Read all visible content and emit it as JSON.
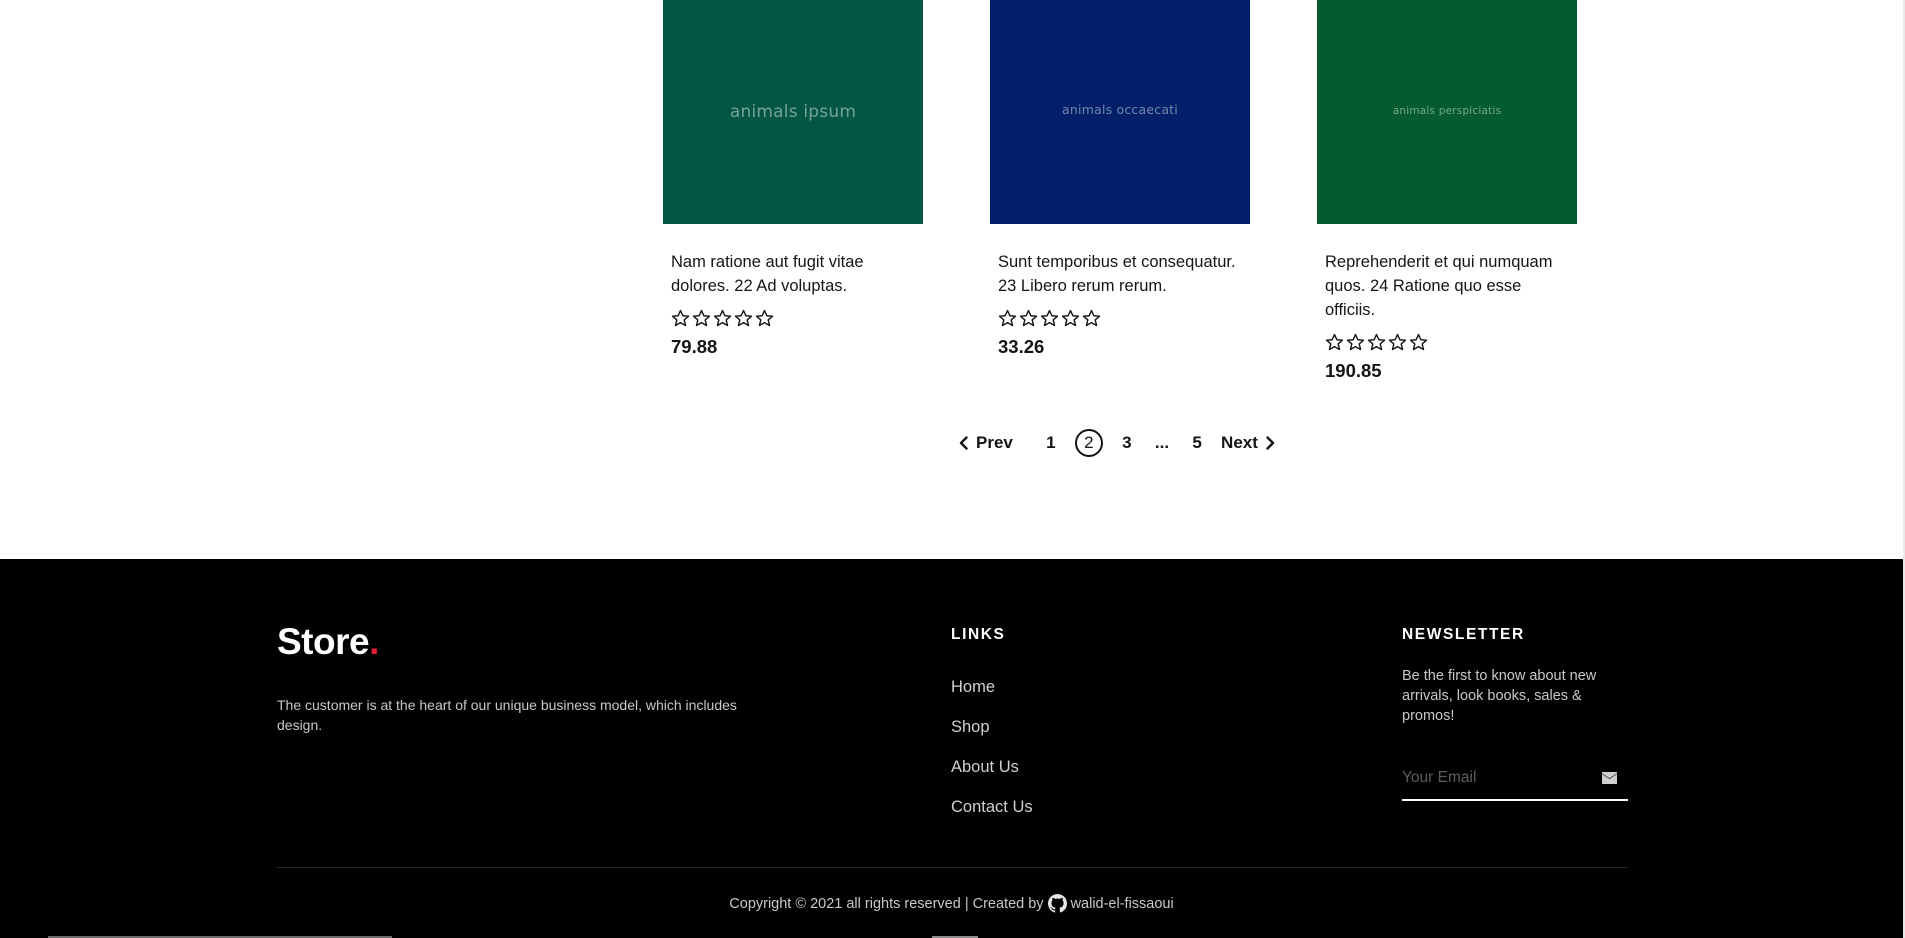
{
  "products": [
    {
      "image_text": "animals ipsum",
      "image_color": "#035645",
      "title": "Nam ratione aut fugit vitae dolores. 22 Ad voluptas.",
      "rating": 0,
      "rating_max": 5,
      "price": "79.88"
    },
    {
      "image_text": "animals occaecati",
      "image_color": "#02206a",
      "title": "Sunt temporibus et consequatur. 23 Libero rerum rerum.",
      "rating": 0,
      "rating_max": 5,
      "price": "33.26"
    },
    {
      "image_text": "animals perspiciatis",
      "image_color": "#035b2e",
      "title": "Reprehenderit et qui numquam quos. 24 Ratione quo esse officiis.",
      "rating": 0,
      "rating_max": 5,
      "price": "190.85"
    }
  ],
  "pagination": {
    "prev_label": "Prev",
    "next_label": "Next",
    "pages": [
      "1",
      "2",
      "3",
      "...",
      "5"
    ],
    "current": "2"
  },
  "footer": {
    "brand": "Store",
    "brand_dot": ".",
    "brand_dot_color": "#e11d38",
    "description": "The customer is at the heart of our unique business model, which includes design.",
    "links_title": "LINKS",
    "links": [
      "Home",
      "Shop",
      "About Us",
      "Contact Us"
    ],
    "newsletter_title": "NEWSLETTER",
    "newsletter_text": "Be the first to know about new arrivals, look books, sales & promos!",
    "email_placeholder": "Your Email",
    "email_value": "",
    "submit_icon": "envelope-icon",
    "copyright_text": "Copyright © 2021 all rights reserved | Created by",
    "author_icon": "github-icon",
    "author": "walid-el-fissaoui"
  }
}
